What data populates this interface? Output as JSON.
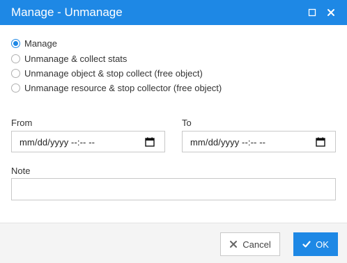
{
  "dialog": {
    "title": "Manage - Unmanage",
    "accent_color": "#1e88e5"
  },
  "titlebar": {
    "maximize_icon": "maximize-icon",
    "close_icon": "close-icon"
  },
  "options": [
    {
      "label": "Manage",
      "checked": true
    },
    {
      "label": "Unmanage & collect stats",
      "checked": false
    },
    {
      "label": "Unmanage object & stop collect (free object)",
      "checked": false
    },
    {
      "label": "Unmanage resource & stop collector (free object)",
      "checked": false
    }
  ],
  "from": {
    "label": "From",
    "value": "mm/dd/yyyy --:-- --",
    "icon": "calendar-icon"
  },
  "to": {
    "label": "To",
    "value": "mm/dd/yyyy --:-- --",
    "icon": "calendar-icon"
  },
  "note": {
    "label": "Note",
    "value": ""
  },
  "footer": {
    "cancel_label": "Cancel",
    "cancel_icon": "x-icon",
    "ok_label": "OK",
    "ok_icon": "checkmark-icon"
  }
}
